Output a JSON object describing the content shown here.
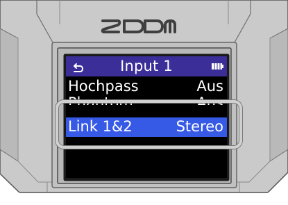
{
  "device": {
    "brand": "ZOOM"
  },
  "screen": {
    "title": "Input 1",
    "back_icon": "back-arrow-icon",
    "battery_icon": "battery-full-icon"
  },
  "menu": {
    "items": [
      {
        "label": "Hochpass",
        "value": "Aus",
        "state": "normal"
      },
      {
        "label": "Phantom",
        "value": "Aus",
        "state": "partially-hidden"
      },
      {
        "label": "Link 1&2",
        "value": "Stereo",
        "state": "selected"
      }
    ]
  },
  "colors": {
    "title_bar": "#3b2e98",
    "selected_row": "#3659e6",
    "screen_background": "#000000",
    "text": "#ffffff",
    "device_body": "#c9c9c9",
    "highlight_frame": "#d0d0d0"
  }
}
